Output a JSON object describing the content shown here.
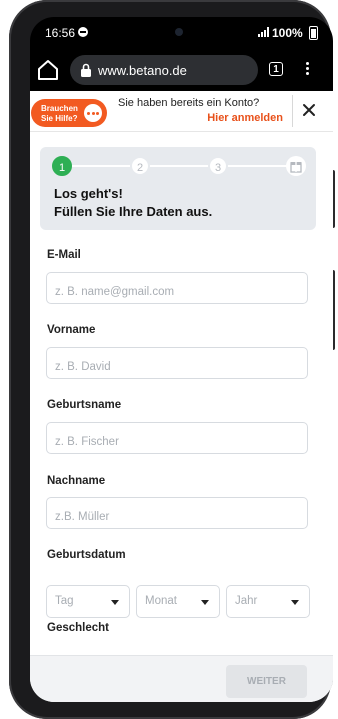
{
  "statusbar": {
    "time": "16:56",
    "battery": "100%"
  },
  "browser": {
    "url": "www.betano.de",
    "tab_count": "1"
  },
  "topbar": {
    "help_line1": "Brauchen",
    "help_line2": "Sie Hilfe?",
    "login_question": "Sie haben bereits ein Konto?",
    "login_link": "Hier anmelden"
  },
  "steps": {
    "items": [
      "1",
      "2",
      "3"
    ],
    "active": 1,
    "title_line1": "Los geht's!",
    "title_line2": "Füllen Sie Ihre Daten aus."
  },
  "form": {
    "email": {
      "label": "E-Mail",
      "placeholder": "z. B. name@gmail.com"
    },
    "firstname": {
      "label": "Vorname",
      "placeholder": "z. B. David"
    },
    "birthname": {
      "label": "Geburtsname",
      "placeholder": "z. B. Fischer"
    },
    "lastname": {
      "label": "Nachname",
      "placeholder": "z.B. Müller"
    },
    "birthdate": {
      "label": "Geburtsdatum",
      "day": "Tag",
      "month": "Monat",
      "year": "Jahr"
    },
    "gender": {
      "label": "Geschlecht"
    }
  },
  "footer": {
    "next_label": "WEITER"
  },
  "colors": {
    "accent": "#f25a21",
    "step_active": "#2eaf54",
    "link": "#e8511b"
  }
}
